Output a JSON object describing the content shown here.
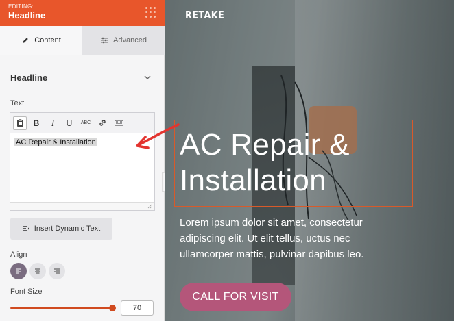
{
  "topbar": {
    "editing_label": "EDITING:",
    "title": "Headline"
  },
  "tabs": [
    {
      "label": "Content",
      "icon": "pencil-icon",
      "active": true
    },
    {
      "label": "Advanced",
      "icon": "sliders-icon",
      "active": false
    }
  ],
  "section": {
    "title": "Headline"
  },
  "text_field": {
    "label": "Text",
    "value": "AC Repair & Installation",
    "toolbar": [
      "paste-icon",
      "B",
      "I",
      "U",
      "ABC",
      "link-icon",
      "keyboard-icon"
    ]
  },
  "insert_button": {
    "label": "Insert Dynamic Text"
  },
  "align": {
    "label": "Align",
    "options": [
      "left",
      "center",
      "right"
    ],
    "selected": "left"
  },
  "font_size": {
    "label": "Font Size",
    "value": "70",
    "slider_fraction": 1.0
  },
  "preview": {
    "logo": "RETAKE",
    "headline": "AC Repair & Installation",
    "body": "Lorem ipsum dolor sit amet, consectetur adipiscing elit. Ut elit tellus, uctus nec ullamcorper mattis, pulvinar dapibus leo.",
    "cta": "CALL FOR VISIT"
  },
  "colors": {
    "accent": "#e8562b",
    "cta": "#b4567a",
    "arrow": "#e3342f"
  }
}
